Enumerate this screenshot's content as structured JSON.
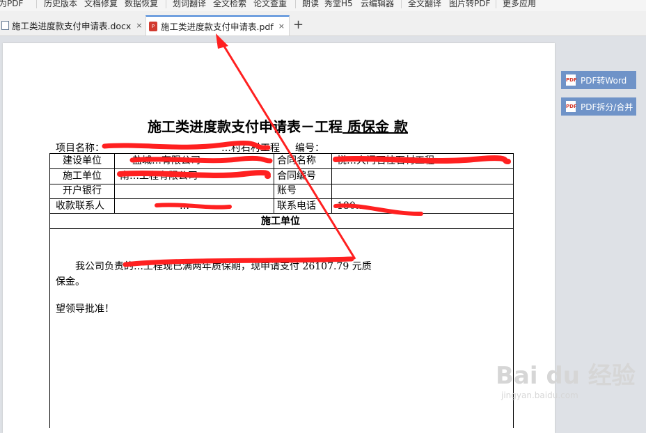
{
  "toolbar": {
    "items": [
      "出为PDF",
      "历史版本",
      "文档修复",
      "数据恢复",
      "划词翻译",
      "全文检索",
      "论文查重",
      "朗读",
      "秀堂H5",
      "云编辑器",
      "全文翻译",
      "图片转PDF",
      "更多应用"
    ]
  },
  "tabs": [
    {
      "label": "施工类进度款支付申请表.docx",
      "close": "×",
      "icon": "word-doc-icon"
    },
    {
      "label": "施工类进度款支付申请表.pdf",
      "close": "×",
      "icon": "pdf-icon"
    }
  ],
  "new_tab": "+",
  "side_buttons": [
    {
      "label": "PDF转Word",
      "icon": "pdf-to-word-icon"
    },
    {
      "label": "PDF拆分/合并",
      "icon": "pdf-split-icon"
    }
  ],
  "form": {
    "title_prefix": "施工类进度款支付申请表－工程",
    "title_underlined": " 质保金 款",
    "project_label": "项目名称：",
    "project_value": "…村石村工程",
    "number_label": "编号：",
    "rows": [
      {
        "l1": "建设单位",
        "v1": "盐城…有限公司",
        "l2": "合同名称",
        "v2": "悦…大门石桂石村工程"
      },
      {
        "l1": "施工单位",
        "v1": "南…工程有限公司",
        "l2": "合同编号",
        "v2": ""
      },
      {
        "l1": "开户银行",
        "v1": "",
        "l2": "账号",
        "v2": ""
      },
      {
        "l1": "收款联系人",
        "v1": "…",
        "l2": "联系电话",
        "v2": "180…"
      }
    ],
    "section_header": "施工单位",
    "body_line1": "我公司负责的…工程现已满两年质保期，现申请支付 26107.79 元质",
    "body_line2": "保金。",
    "approval": "望领导批准！"
  },
  "watermark": {
    "big": "Bai du 经验",
    "small": "jingyan.baidu.com"
  },
  "colors": {
    "accent": "#4a88d8",
    "annotation": "#ff2020",
    "side_button": "#6f93c8"
  }
}
